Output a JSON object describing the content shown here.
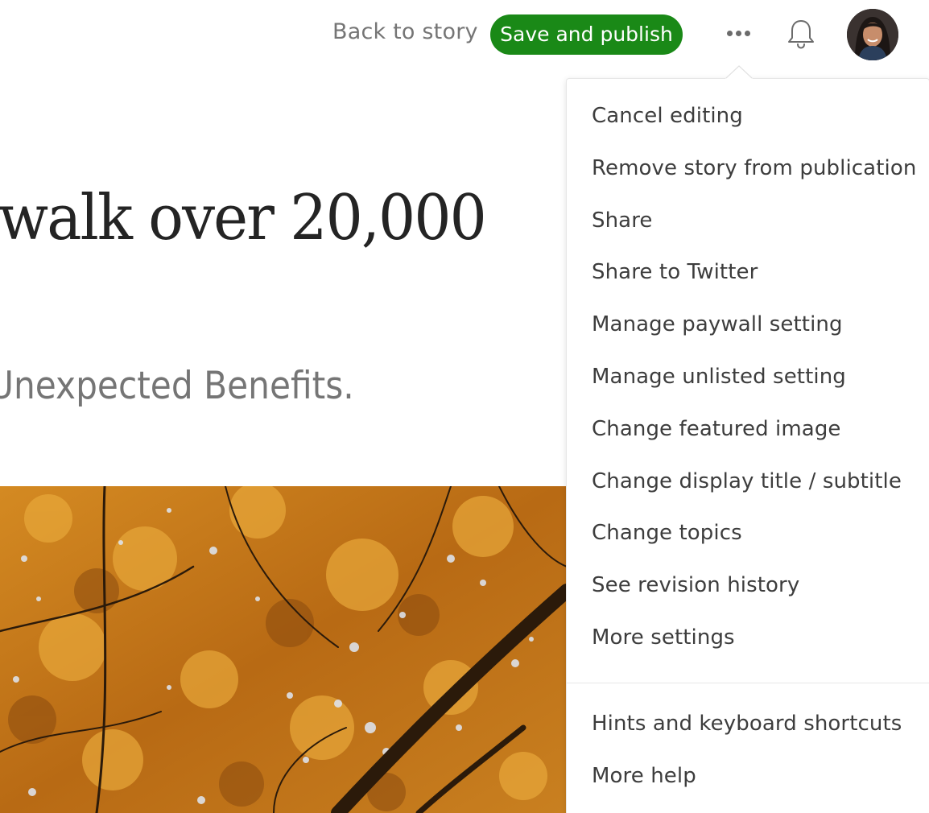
{
  "header": {
    "back_label": "Back to story",
    "publish_label": "Save and publish",
    "accent_color": "#1a8917",
    "more_icon": "more-horizontal-icon",
    "notifications_icon": "bell-icon",
    "avatar_icon": "user-avatar"
  },
  "story": {
    "title_visible": "walk over 20,000",
    "subtitle_visible": "Unexpected Benefits."
  },
  "menu": {
    "items": [
      {
        "label": "Cancel editing"
      },
      {
        "label": "Remove story from publication"
      },
      {
        "label": "Share"
      },
      {
        "label": "Share to Twitter"
      },
      {
        "label": "Manage paywall setting"
      },
      {
        "label": "Manage unlisted setting"
      },
      {
        "label": "Change featured image"
      },
      {
        "label": "Change display title / subtitle"
      },
      {
        "label": "Change topics"
      },
      {
        "label": "See revision history"
      },
      {
        "label": "More settings"
      }
    ],
    "help_items": [
      {
        "label": "Hints and keyboard shortcuts"
      },
      {
        "label": "More help"
      }
    ]
  }
}
